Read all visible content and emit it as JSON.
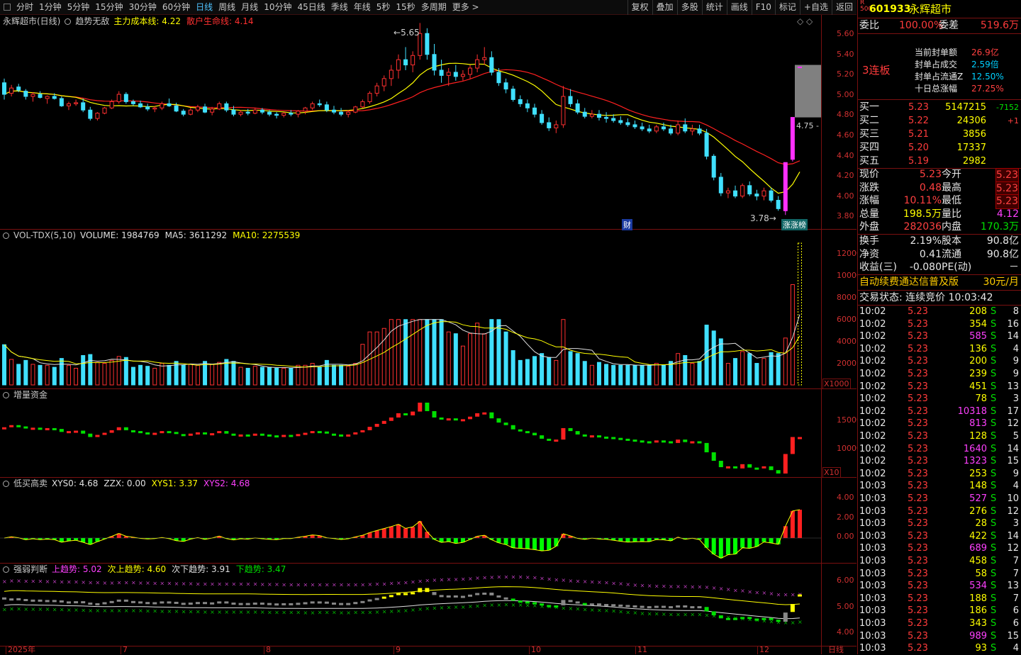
{
  "toolbar": {
    "periods": [
      "分时",
      "1分钟",
      "5分钟",
      "15分钟",
      "30分钟",
      "60分钟",
      "日线",
      "周线",
      "月线",
      "10分钟",
      "45日线",
      "季线",
      "年线",
      "5秒",
      "15秒",
      "多周期",
      "更多 >"
    ],
    "active": "日线",
    "actions": [
      "复权",
      "叠加",
      "多股",
      "统计",
      "画线",
      "F10",
      "标记",
      "+自选",
      "返回"
    ]
  },
  "main": {
    "title": "永辉超市(日线)",
    "indicator": "趋势无敌",
    "ind_items": [
      {
        "label": "主力成本线: 4.22",
        "color": "#ffff00"
      },
      {
        "label": "散户生命线: 4.14",
        "color": "#ff3030"
      }
    ],
    "yticks": [
      "5.60",
      "5.40",
      "5.20",
      "5.00",
      "4.80",
      "4.60",
      "4.40",
      "4.20",
      "4.00",
      "3.80"
    ],
    "high_label": "5.65",
    "low_label": "3.78",
    "limit_label": "4.75",
    "fin_tag": "财",
    "limitup_tag": "涨涨榜"
  },
  "vol": {
    "title": "VOL-TDX(5,10)",
    "items": [
      {
        "label": "VOLUME: 1984769",
        "color": "#e0e0e0"
      },
      {
        "label": "MA5: 3611292",
        "color": "#e0e0e0"
      },
      {
        "label": "MA10: 2275539",
        "color": "#ffff00"
      }
    ],
    "yticks": [
      "12000",
      "10000",
      "8000",
      "6000",
      "4000",
      "2000"
    ],
    "unit": "X1000"
  },
  "fund": {
    "title": "增量资金",
    "yticks": [
      "15000",
      "10000"
    ],
    "unit": "X10"
  },
  "lbhs": {
    "title": "低买高卖",
    "items": [
      {
        "label": "XYS0: 4.68",
        "color": "#e0e0e0"
      },
      {
        "label": "ZZX: 0.00",
        "color": "#e0e0e0"
      },
      {
        "label": "XYS1: 3.37",
        "color": "#ffff00"
      },
      {
        "label": "XYS2: 4.68",
        "color": "#ff40ff"
      }
    ],
    "yticks": [
      "4.00",
      "2.00",
      "0.00"
    ]
  },
  "qrpd": {
    "title": "强弱判断",
    "items": [
      {
        "label": "上趋势: 5.02",
        "color": "#ff40ff"
      },
      {
        "label": "次上趋势: 4.60",
        "color": "#ffff00"
      },
      {
        "label": "次下趋势: 3.91",
        "color": "#e0e0e0"
      },
      {
        "label": "下趋势: 3.47",
        "color": "#00e000"
      }
    ],
    "yticks": [
      "6.00",
      "5.00",
      "4.00"
    ]
  },
  "xaxis": [
    "2025年",
    "7",
    "8",
    "9",
    "10",
    "11",
    "12"
  ],
  "xaxis_tail": "日线",
  "quote": {
    "market_tag": "R\n500",
    "code": "601933",
    "name": "永辉超市",
    "weibi_label": "委比",
    "weibi": "100.00%",
    "weicha_label": "委差",
    "weicha": "519.6万",
    "limit_board": "3连板",
    "seal": [
      {
        "k": "当前封单额",
        "v": "26.9亿"
      },
      {
        "k": "封单占成交",
        "v": "2.59倍"
      },
      {
        "k": "封单占流通Z",
        "v": "12.50%"
      },
      {
        "k": "十日总涨幅",
        "v": "27.25%"
      }
    ],
    "bids": [
      {
        "k": "买一",
        "p": "5.23",
        "v": "5147215",
        "d": "-7152"
      },
      {
        "k": "买二",
        "p": "5.22",
        "v": "24306",
        "d": "+1"
      },
      {
        "k": "买三",
        "p": "5.21",
        "v": "3856",
        "d": ""
      },
      {
        "k": "买四",
        "p": "5.20",
        "v": "17337",
        "d": ""
      },
      {
        "k": "买五",
        "p": "5.19",
        "v": "2982",
        "d": ""
      }
    ],
    "stats": [
      {
        "k1": "现价",
        "v1": "5.23",
        "k2": "今开",
        "v2": "5.23"
      },
      {
        "k1": "涨跌",
        "v1": "0.48",
        "k2": "最高",
        "v2": "5.23"
      },
      {
        "k1": "涨幅",
        "v1": "10.11%",
        "k2": "最低",
        "v2": "5.23"
      },
      {
        "k1": "总量",
        "v1": "198.5万",
        "k2": "量比",
        "v2": "4.12"
      },
      {
        "k1": "外盘",
        "v1": "282036",
        "k2": "内盘",
        "v2": "170.3万"
      }
    ],
    "stats2": [
      {
        "k1": "换手",
        "v1": "2.19%",
        "k2": "股本",
        "v2": "90.8亿"
      },
      {
        "k1": "净资",
        "v1": "0.41",
        "k2": "流通",
        "v2": "90.8亿"
      },
      {
        "k1": "收益(三)",
        "v1": "-0.080",
        "k2": "PE(动)",
        "v2": "－"
      }
    ],
    "ad": "自动续费通达信普及版",
    "ad_price": "30元/月",
    "status": "交易状态: 连续竞价 10:03:42",
    "ticks": [
      [
        "10:02",
        "5.23",
        "208",
        "S",
        "8"
      ],
      [
        "10:02",
        "5.23",
        "354",
        "S",
        "16"
      ],
      [
        "10:02",
        "5.23",
        "585",
        "S",
        "14"
      ],
      [
        "10:02",
        "5.23",
        "136",
        "S",
        "4"
      ],
      [
        "10:02",
        "5.23",
        "200",
        "S",
        "9"
      ],
      [
        "10:02",
        "5.23",
        "239",
        "S",
        "9"
      ],
      [
        "10:02",
        "5.23",
        "451",
        "S",
        "13"
      ],
      [
        "10:02",
        "5.23",
        "78",
        "S",
        "3"
      ],
      [
        "10:02",
        "5.23",
        "10318",
        "S",
        "17"
      ],
      [
        "10:02",
        "5.23",
        "813",
        "S",
        "12"
      ],
      [
        "10:02",
        "5.23",
        "128",
        "S",
        "5"
      ],
      [
        "10:02",
        "5.23",
        "1640",
        "S",
        "14"
      ],
      [
        "10:02",
        "5.23",
        "1323",
        "S",
        "15"
      ],
      [
        "10:02",
        "5.23",
        "253",
        "S",
        "9"
      ],
      [
        "10:03",
        "5.23",
        "148",
        "S",
        "4"
      ],
      [
        "10:03",
        "5.23",
        "527",
        "S",
        "10"
      ],
      [
        "10:03",
        "5.23",
        "276",
        "S",
        "12"
      ],
      [
        "10:03",
        "5.23",
        "28",
        "S",
        "3"
      ],
      [
        "10:03",
        "5.23",
        "422",
        "S",
        "14"
      ],
      [
        "10:03",
        "5.23",
        "689",
        "S",
        "12"
      ],
      [
        "10:03",
        "5.23",
        "458",
        "S",
        "7"
      ],
      [
        "10:03",
        "5.23",
        "58",
        "S",
        "7"
      ],
      [
        "10:03",
        "5.23",
        "534",
        "S",
        "13"
      ],
      [
        "10:03",
        "5.23",
        "188",
        "S",
        "7"
      ],
      [
        "10:03",
        "5.23",
        "186",
        "S",
        "6"
      ],
      [
        "10:03",
        "5.23",
        "343",
        "S",
        "6"
      ],
      [
        "10:03",
        "5.23",
        "989",
        "S",
        "15"
      ],
      [
        "10:03",
        "5.23",
        "93",
        "S",
        "4"
      ]
    ]
  },
  "chart_data": {
    "type": "candlestick",
    "series_desc": "daily OHLC approx",
    "price_ylim": [
      3.7,
      5.7
    ],
    "ohlc": [
      [
        5.08,
        5.12,
        4.92,
        4.97
      ],
      [
        4.98,
        5.06,
        4.95,
        5.03
      ],
      [
        5.04,
        5.07,
        4.99,
        5.01
      ],
      [
        5.0,
        5.02,
        4.92,
        4.95
      ],
      [
        4.95,
        4.99,
        4.9,
        4.97
      ],
      [
        4.97,
        5.0,
        4.93,
        4.94
      ],
      [
        4.93,
        4.96,
        4.88,
        4.95
      ],
      [
        4.95,
        4.98,
        4.92,
        4.93
      ],
      [
        4.93,
        4.95,
        4.85,
        4.86
      ],
      [
        4.86,
        4.9,
        4.82,
        4.88
      ],
      [
        4.88,
        4.92,
        4.86,
        4.89
      ],
      [
        4.89,
        4.93,
        4.8,
        4.82
      ],
      [
        4.82,
        4.85,
        4.72,
        4.74
      ],
      [
        4.74,
        4.8,
        4.72,
        4.79
      ],
      [
        4.79,
        4.85,
        4.78,
        4.84
      ],
      [
        4.84,
        4.92,
        4.83,
        4.9
      ],
      [
        4.9,
        5.0,
        4.88,
        4.97
      ],
      [
        4.97,
        4.99,
        4.88,
        4.9
      ],
      [
        4.9,
        4.92,
        4.86,
        4.88
      ],
      [
        4.88,
        4.91,
        4.84,
        4.85
      ],
      [
        4.85,
        4.88,
        4.81,
        4.83
      ],
      [
        4.83,
        4.86,
        4.8,
        4.84
      ],
      [
        4.84,
        4.9,
        4.82,
        4.88
      ],
      [
        4.88,
        4.93,
        4.85,
        4.86
      ],
      [
        4.86,
        4.89,
        4.8,
        4.81
      ],
      [
        4.81,
        4.83,
        4.76,
        4.78
      ],
      [
        4.78,
        4.84,
        4.77,
        4.82
      ],
      [
        4.82,
        4.87,
        4.8,
        4.85
      ],
      [
        4.85,
        4.88,
        4.79,
        4.8
      ],
      [
        4.8,
        4.85,
        4.77,
        4.83
      ],
      [
        4.83,
        4.9,
        4.82,
        4.88
      ],
      [
        4.88,
        4.9,
        4.8,
        4.82
      ],
      [
        4.82,
        4.86,
        4.76,
        4.78
      ],
      [
        4.78,
        4.82,
        4.76,
        4.8
      ],
      [
        4.8,
        4.83,
        4.77,
        4.79
      ],
      [
        4.79,
        4.84,
        4.78,
        4.82
      ],
      [
        4.82,
        4.84,
        4.78,
        4.8
      ],
      [
        4.8,
        4.82,
        4.76,
        4.78
      ],
      [
        4.78,
        4.8,
        4.74,
        4.77
      ],
      [
        4.77,
        4.8,
        4.75,
        4.79
      ],
      [
        4.79,
        4.82,
        4.76,
        4.78
      ],
      [
        4.78,
        4.82,
        4.75,
        4.81
      ],
      [
        4.81,
        4.85,
        4.78,
        4.84
      ],
      [
        4.84,
        4.9,
        4.82,
        4.88
      ],
      [
        4.88,
        4.92,
        4.85,
        4.87
      ],
      [
        4.87,
        4.9,
        4.8,
        4.82
      ],
      [
        4.82,
        4.86,
        4.78,
        4.8
      ],
      [
        4.8,
        4.84,
        4.76,
        4.78
      ],
      [
        4.78,
        4.82,
        4.75,
        4.8
      ],
      [
        4.8,
        4.86,
        4.79,
        4.85
      ],
      [
        4.85,
        4.92,
        4.84,
        4.9
      ],
      [
        4.9,
        5.0,
        4.88,
        4.98
      ],
      [
        4.98,
        5.08,
        4.95,
        5.05
      ],
      [
        5.05,
        5.15,
        5.0,
        5.12
      ],
      [
        5.12,
        5.25,
        5.05,
        5.2
      ],
      [
        5.2,
        5.35,
        5.12,
        5.3
      ],
      [
        5.3,
        5.42,
        5.2,
        5.25
      ],
      [
        5.25,
        5.38,
        5.18,
        5.34
      ],
      [
        5.34,
        5.65,
        5.3,
        5.55
      ],
      [
        5.55,
        5.6,
        5.3,
        5.35
      ],
      [
        5.35,
        5.45,
        5.15,
        5.2
      ],
      [
        5.2,
        5.3,
        5.08,
        5.15
      ],
      [
        5.15,
        5.22,
        5.05,
        5.18
      ],
      [
        5.18,
        5.25,
        5.1,
        5.14
      ],
      [
        5.14,
        5.2,
        5.1,
        5.16
      ],
      [
        5.16,
        5.25,
        5.12,
        5.22
      ],
      [
        5.22,
        5.35,
        5.18,
        5.3
      ],
      [
        5.3,
        5.42,
        5.25,
        5.32
      ],
      [
        5.32,
        5.38,
        5.15,
        5.18
      ],
      [
        5.18,
        5.22,
        5.05,
        5.08
      ],
      [
        5.08,
        5.12,
        4.98,
        5.02
      ],
      [
        5.02,
        5.05,
        4.9,
        4.92
      ],
      [
        4.92,
        4.96,
        4.85,
        4.88
      ],
      [
        4.88,
        4.92,
        4.8,
        4.84
      ],
      [
        4.84,
        4.88,
        4.75,
        4.78
      ],
      [
        4.78,
        4.82,
        4.68,
        4.7
      ],
      [
        4.7,
        4.75,
        4.62,
        4.65
      ],
      [
        4.65,
        4.72,
        4.6,
        4.68
      ],
      [
        4.68,
        5.05,
        4.65,
        4.95
      ],
      [
        4.95,
        5.02,
        4.85,
        4.88
      ],
      [
        4.88,
        4.92,
        4.78,
        4.8
      ],
      [
        4.8,
        4.84,
        4.74,
        4.76
      ],
      [
        4.76,
        4.82,
        4.74,
        4.78
      ],
      [
        4.78,
        4.82,
        4.72,
        4.75
      ],
      [
        4.75,
        4.8,
        4.7,
        4.74
      ],
      [
        4.74,
        4.78,
        4.7,
        4.72
      ],
      [
        4.72,
        4.76,
        4.68,
        4.7
      ],
      [
        4.7,
        4.74,
        4.66,
        4.68
      ],
      [
        4.68,
        4.72,
        4.64,
        4.66
      ],
      [
        4.66,
        4.7,
        4.62,
        4.64
      ],
      [
        4.64,
        4.68,
        4.6,
        4.62
      ],
      [
        4.62,
        4.68,
        4.6,
        4.66
      ],
      [
        4.66,
        4.7,
        4.62,
        4.64
      ],
      [
        4.64,
        4.68,
        4.58,
        4.6
      ],
      [
        4.6,
        4.72,
        4.58,
        4.68
      ],
      [
        4.68,
        4.74,
        4.6,
        4.62
      ],
      [
        4.62,
        4.68,
        4.58,
        4.64
      ],
      [
        4.64,
        4.68,
        4.58,
        4.6
      ],
      [
        4.6,
        4.64,
        4.35,
        4.38
      ],
      [
        4.38,
        4.4,
        4.15,
        4.18
      ],
      [
        4.18,
        4.22,
        4.0,
        4.03
      ],
      [
        4.03,
        4.08,
        3.98,
        4.05
      ],
      [
        4.05,
        4.1,
        3.98,
        4.0
      ],
      [
        4.0,
        4.12,
        3.98,
        4.1
      ],
      [
        4.1,
        4.14,
        4.0,
        4.02
      ],
      [
        4.02,
        4.06,
        3.96,
        4.0
      ],
      [
        4.0,
        4.08,
        3.96,
        4.05
      ],
      [
        4.05,
        4.08,
        3.94,
        3.96
      ],
      [
        3.96,
        4.0,
        3.86,
        3.88
      ],
      [
        3.86,
        4.32,
        3.82,
        4.32
      ],
      [
        4.35,
        4.75,
        4.33,
        4.75
      ],
      [
        5.23,
        5.23,
        5.23,
        5.23
      ]
    ]
  }
}
